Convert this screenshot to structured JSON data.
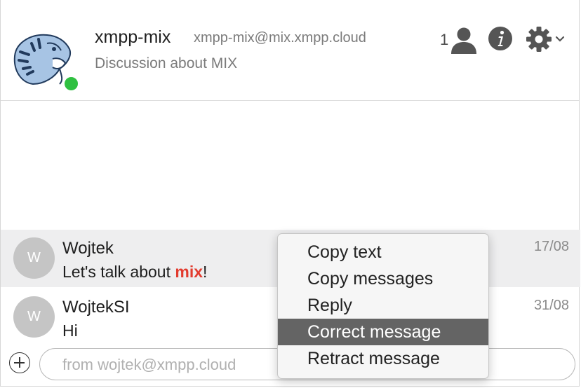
{
  "header": {
    "room_name": "xmpp-mix",
    "room_jid": "xmpp-mix@mix.xmpp.cloud",
    "description": "Discussion about MIX",
    "occupant_count": "1",
    "presence_color": "#2fc041",
    "icons": [
      "tiger-avatar",
      "person-icon",
      "info-icon",
      "gear-icon",
      "chevron-down-icon"
    ]
  },
  "messages": [
    {
      "avatar_initial": "W",
      "author": "Wojtek",
      "body_prefix": "Let's talk about ",
      "mention": "mix",
      "body_suffix": "!",
      "date": "17/08"
    },
    {
      "avatar_initial": "W",
      "author": "WojtekSI",
      "body": "Hi",
      "date": "31/08"
    }
  ],
  "composer": {
    "placeholder": "from wojtek@xmpp.cloud"
  },
  "context_menu": {
    "items": [
      "Copy text",
      "Copy messages",
      "Reply",
      "Correct message",
      "Retract message"
    ],
    "selected": "Correct message"
  },
  "colors": {
    "mention": "#e23b2e",
    "menu_selected": "#646464"
  }
}
